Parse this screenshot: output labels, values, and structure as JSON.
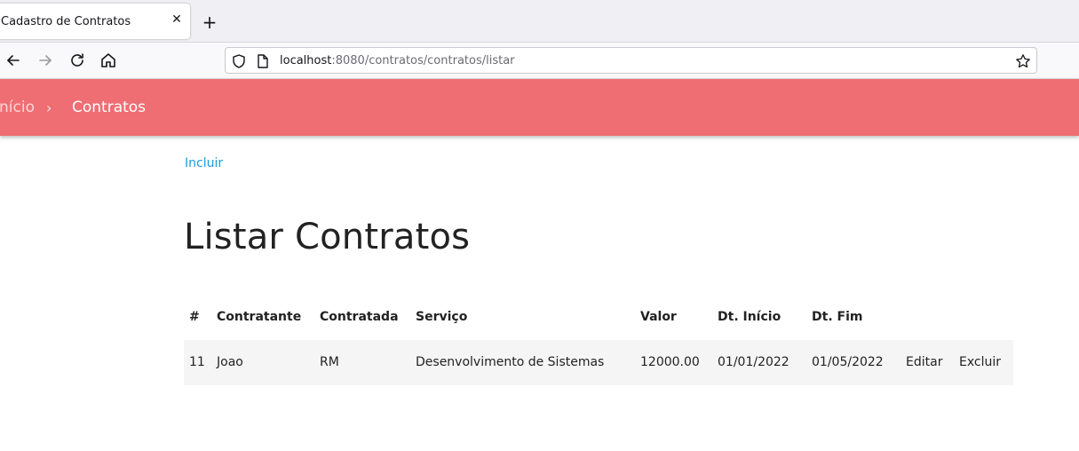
{
  "browser": {
    "tab_title": "Cadastro de Contratos",
    "tab_close": "✕",
    "new_tab": "+",
    "url_host": "localhost",
    "url_rest": ":8080/contratos/contratos/listar"
  },
  "appbar": {
    "breadcrumb_home": "nício",
    "breadcrumb_sep": "›",
    "breadcrumb_current": "Contratos"
  },
  "page": {
    "incluir_label": "Incluir",
    "title": "Listar Contratos"
  },
  "table": {
    "headers": [
      "#",
      "Contratante",
      "Contratada",
      "Serviço",
      "Valor",
      "Dt. Início",
      "Dt. Fim"
    ],
    "rows": [
      {
        "id": "11",
        "contratante": "Joao",
        "contratada": "RM",
        "servico": "Desenvolvimento de Sistemas",
        "valor": "12000.00",
        "dt_inicio": "01/01/2022",
        "dt_fim": "01/05/2022",
        "edit_label": "Editar",
        "delete_label": "Excluir"
      }
    ]
  },
  "colors": {
    "appbar": "#ef6e73",
    "link": "#1a9dd9"
  },
  "icons": [
    "back-icon",
    "forward-icon",
    "reload-icon",
    "home-icon",
    "shield-icon",
    "page-icon",
    "bookmark-star-icon"
  ]
}
